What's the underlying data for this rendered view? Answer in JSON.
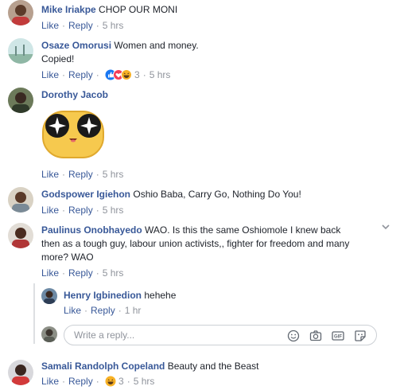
{
  "labels": {
    "like": "Like",
    "reply": "Reply",
    "dot": "·"
  },
  "comments": [
    {
      "name": "Mike Iriakpe",
      "text": "CHOP OUR MONI",
      "time": "5 hrs"
    },
    {
      "name": "Osaze Omorusi",
      "text": "Women and money.",
      "text2": "Copied!",
      "reaction_count": "3",
      "time": "5 hrs"
    },
    {
      "name": "Dorothy Jacob",
      "text": "",
      "sticker": "sunglasses-emoji-sticker",
      "time": "5 hrs"
    },
    {
      "name": "Godspower Igiehon",
      "text": "Oshio Baba, Carry Go, Nothing Do You!",
      "time": "5 hrs"
    },
    {
      "name": "Paulinus Onobhayedo",
      "text": "WAO. Is this the same Oshiomole I knew back",
      "text2": "then as a tough guy, labour union activists,, fighter for freedom and many",
      "text3": "more? WAO",
      "time": "5 hrs"
    },
    {
      "name": "Samali Randolph Copeland",
      "text": "Beauty and the Beast",
      "reaction_count": "3",
      "time": "5 hrs"
    }
  ],
  "nested_reply": {
    "name": "Henry Igbinedion",
    "text": "hehehe",
    "time": "1 hr"
  },
  "reply_box": {
    "placeholder": "Write a reply..."
  },
  "icons": [
    "smiley-icon",
    "camera-icon",
    "gif-icon",
    "sticker-icon",
    "more-options-icon"
  ],
  "colors": {
    "name": "#385898",
    "meta": "#90949c",
    "text": "#1d2129",
    "like_blue": "#1877f2",
    "love_red": "#f33e58",
    "haha_yellow": "#f7b125"
  }
}
